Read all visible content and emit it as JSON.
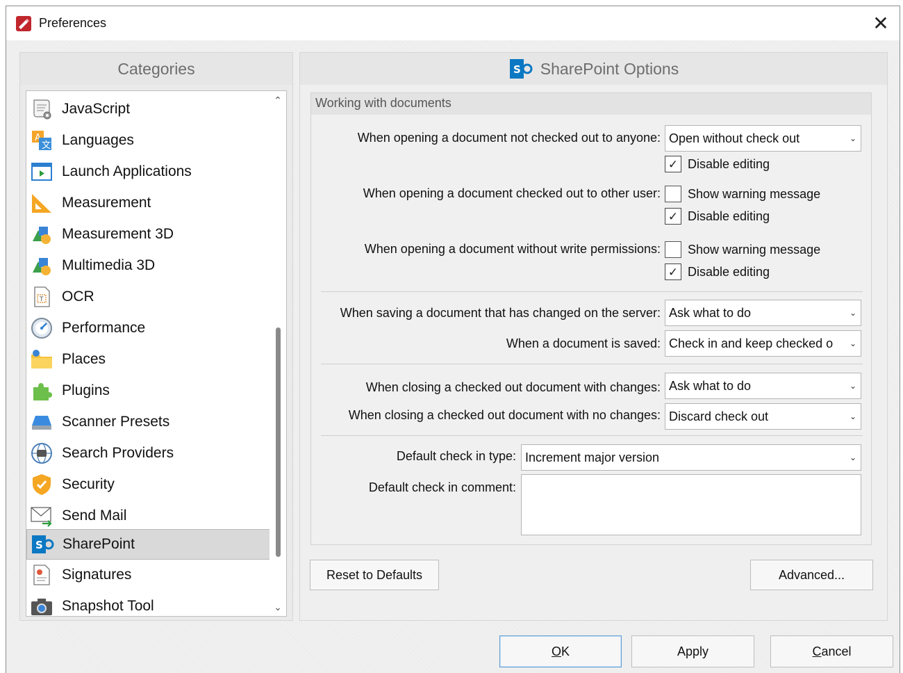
{
  "window": {
    "title": "Preferences",
    "close_glyph": "✕"
  },
  "categories": {
    "header": "Categories",
    "items": [
      {
        "label": "JavaScript",
        "icon": "javascript-icon"
      },
      {
        "label": "Languages",
        "icon": "languages-icon"
      },
      {
        "label": "Launch Applications",
        "icon": "launch-applications-icon"
      },
      {
        "label": "Measurement",
        "icon": "measurement-icon"
      },
      {
        "label": "Measurement 3D",
        "icon": "measurement-3d-icon"
      },
      {
        "label": "Multimedia 3D",
        "icon": "multimedia-3d-icon"
      },
      {
        "label": "OCR",
        "icon": "ocr-icon"
      },
      {
        "label": "Performance",
        "icon": "performance-icon"
      },
      {
        "label": "Places",
        "icon": "places-icon"
      },
      {
        "label": "Plugins",
        "icon": "plugins-icon"
      },
      {
        "label": "Scanner Presets",
        "icon": "scanner-presets-icon"
      },
      {
        "label": "Search Providers",
        "icon": "search-providers-icon"
      },
      {
        "label": "Security",
        "icon": "security-icon"
      },
      {
        "label": "Send Mail",
        "icon": "send-mail-icon"
      },
      {
        "label": "SharePoint",
        "icon": "sharepoint-icon"
      },
      {
        "label": "Signatures",
        "icon": "signatures-icon"
      },
      {
        "label": "Snapshot Tool",
        "icon": "snapshot-tool-icon"
      }
    ],
    "selected": "SharePoint"
  },
  "options": {
    "header": "SharePoint Options",
    "group_title": "Working with documents",
    "open_not_checked_out": {
      "label": "When opening a document not checked out to anyone:",
      "value": "Open without check out",
      "disable_editing": {
        "label": "Disable editing",
        "checked": true
      }
    },
    "open_checked_out_other": {
      "label": "When opening a document checked out to other user:",
      "show_warning": {
        "label": "Show warning message",
        "checked": false
      },
      "disable_editing": {
        "label": "Disable editing",
        "checked": true
      }
    },
    "open_no_write": {
      "label": "When opening a document without write permissions:",
      "show_warning": {
        "label": "Show warning message",
        "checked": false
      },
      "disable_editing": {
        "label": "Disable editing",
        "checked": true
      }
    },
    "saving_changed_on_server": {
      "label": "When saving a document that has changed on the server:",
      "value": "Ask what to do"
    },
    "document_saved": {
      "label": "When a document is saved:",
      "value": "Check in and keep checked o"
    },
    "closing_with_changes": {
      "label": "When closing a checked out document with changes:",
      "value": "Ask what to do"
    },
    "closing_no_changes": {
      "label": "When closing a checked out document with no changes:",
      "value": "Discard check out"
    },
    "default_checkin_type": {
      "label": "Default check in type:",
      "value": "Increment major version"
    },
    "default_checkin_comment": {
      "label": "Default check in comment:",
      "value": ""
    },
    "reset_button": "Reset to Defaults",
    "advanced_button": "Advanced..."
  },
  "footer": {
    "ok": {
      "label": "OK",
      "mnemonic": "O",
      "rest": "K"
    },
    "apply": {
      "label": "Apply",
      "mnemonic": "",
      "rest": "Apply"
    },
    "cancel": {
      "label": "Cancel",
      "mnemonic": "C",
      "rest": "ancel"
    }
  },
  "colors": {
    "accent": "#1e6fc7",
    "selected_bg": "#d9d9d9",
    "sharepoint_blue": "#0b78c3"
  }
}
